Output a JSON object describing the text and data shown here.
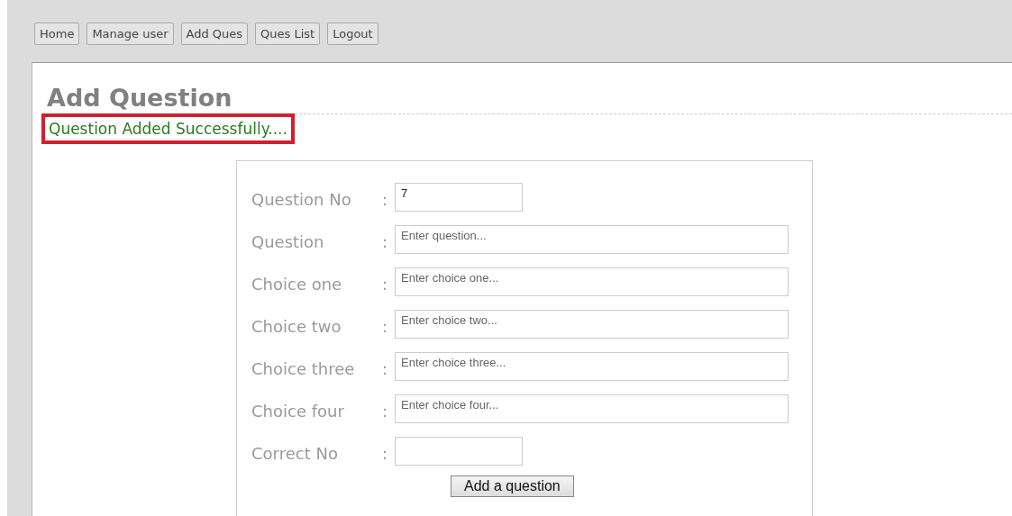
{
  "nav": [
    {
      "label": "Home"
    },
    {
      "label": "Manage user"
    },
    {
      "label": "Add Ques"
    },
    {
      "label": "Ques List"
    },
    {
      "label": "Logout"
    }
  ],
  "heading": "Add Question",
  "message": "Question Added Successfully....",
  "form": {
    "fields": [
      {
        "label": "Question No",
        "separator": ":",
        "kind": "short",
        "value": "7"
      },
      {
        "label": "Question",
        "separator": ":",
        "kind": "long",
        "placeholder": "Enter question..."
      },
      {
        "label": "Choice one",
        "separator": ":",
        "kind": "long",
        "placeholder": "Enter choice one..."
      },
      {
        "label": "Choice two",
        "separator": ":",
        "kind": "long",
        "placeholder": "Enter choice two..."
      },
      {
        "label": "Choice three",
        "separator": ":",
        "kind": "long",
        "placeholder": "Enter choice three..."
      },
      {
        "label": "Choice four",
        "separator": ":",
        "kind": "long",
        "placeholder": "Enter choice four..."
      },
      {
        "label": "Correct No",
        "separator": ":",
        "kind": "short"
      }
    ],
    "submit": "Add a question"
  }
}
